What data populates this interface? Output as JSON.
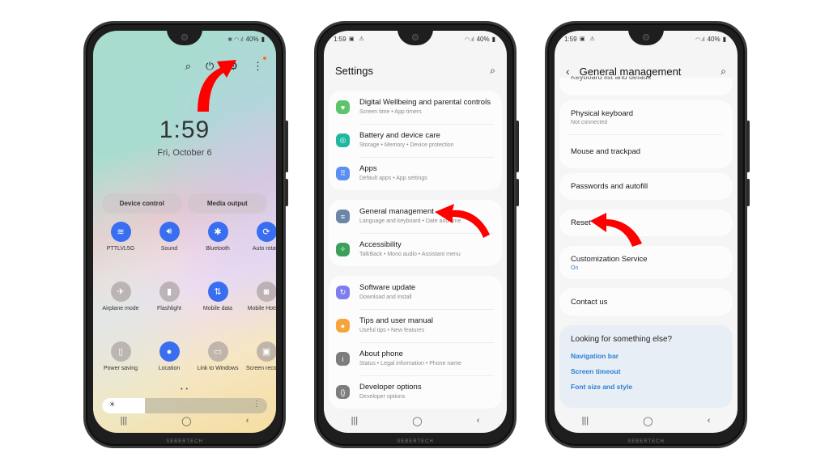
{
  "status_bar": {
    "time": "1:59",
    "battery": "40%",
    "notification_icons": "▣ ⚠",
    "signal_icons": "✱ ◠.ıl"
  },
  "phone1": {
    "top_icons": [
      "search-icon",
      "power-icon",
      "settings-gear-icon",
      "more-options-icon"
    ],
    "clock": "1:59",
    "date": "Fri, October 6",
    "pills": [
      "Device control",
      "Media output"
    ],
    "tiles": [
      {
        "label": "PTTLVL5G",
        "icon": "wifi-icon",
        "glyph": "≋",
        "on": true
      },
      {
        "label": "Sound",
        "icon": "sound-icon",
        "glyph": "🔊︎",
        "on": true
      },
      {
        "label": "Bluetooth",
        "icon": "bluetooth-icon",
        "glyph": "✱",
        "on": true
      },
      {
        "label": "Auto rotate",
        "icon": "auto-rotate-icon",
        "glyph": "⟳",
        "on": true
      },
      {
        "label": "Airplane mode",
        "icon": "airplane-icon",
        "glyph": "✈",
        "on": false
      },
      {
        "label": "Flashlight",
        "icon": "flashlight-icon",
        "glyph": "▮",
        "on": false
      },
      {
        "label": "Mobile data",
        "icon": "mobile-data-icon",
        "glyph": "⇅",
        "on": true
      },
      {
        "label": "Mobile Hotspot",
        "icon": "hotspot-icon",
        "glyph": "◙",
        "on": false
      },
      {
        "label": "Power saving",
        "icon": "power-saving-icon",
        "glyph": "▯",
        "on": false
      },
      {
        "label": "Location",
        "icon": "location-icon",
        "glyph": "●",
        "on": true
      },
      {
        "label": "Link to Windows",
        "icon": "link-to-windows-icon",
        "glyph": "▭",
        "on": false
      },
      {
        "label": "Screen recorder",
        "icon": "screen-recorder-icon",
        "glyph": "▣",
        "on": false
      }
    ],
    "page_dots": "• •",
    "brightness_level": 0.26
  },
  "phone2": {
    "title": "Settings",
    "groups": [
      [
        {
          "title": "Digital Wellbeing and parental controls",
          "subtitle": "Screen time  •  App timers",
          "icon": "digital-wellbeing-icon",
          "color": "#5cc56b",
          "glyph": "♥"
        },
        {
          "title": "Battery and device care",
          "subtitle": "Storage  •  Memory  •  Device protection",
          "icon": "battery-care-icon",
          "color": "#1fb7a0",
          "glyph": "◎"
        },
        {
          "title": "Apps",
          "subtitle": "Default apps  •  App settings",
          "icon": "apps-icon",
          "color": "#5b8ff2",
          "glyph": "⠿"
        }
      ],
      [
        {
          "title": "General management",
          "subtitle": "Language and keyboard  •  Date and time",
          "icon": "general-management-icon",
          "color": "#6b86a6",
          "glyph": "≡"
        },
        {
          "title": "Accessibility",
          "subtitle": "TalkBack  •  Mono audio  •  Assistant menu",
          "icon": "accessibility-icon",
          "color": "#3ca05a",
          "glyph": "✧"
        }
      ],
      [
        {
          "title": "Software update",
          "subtitle": "Download and install",
          "icon": "software-update-icon",
          "color": "#7d7df0",
          "glyph": "↻"
        },
        {
          "title": "Tips and user manual",
          "subtitle": "Useful tips  •  New features",
          "icon": "tips-icon",
          "color": "#f6a53a",
          "glyph": "●"
        },
        {
          "title": "About phone",
          "subtitle": "Status  •  Legal information  •  Phone name",
          "icon": "about-phone-icon",
          "color": "#7d7d7d",
          "glyph": "i"
        },
        {
          "title": "Developer options",
          "subtitle": "Developer options",
          "icon": "developer-options-icon",
          "color": "#7d7d7d",
          "glyph": "{}"
        }
      ]
    ]
  },
  "phone3": {
    "title": "General management",
    "cut_off_item": "Keyboard list and default",
    "items": [
      {
        "title": "Physical keyboard",
        "subtitle": "Not connected"
      },
      {
        "title": "Mouse and trackpad"
      },
      {
        "title": "Passwords and autofill"
      },
      {
        "title": "Reset"
      },
      {
        "title": "Customization Service",
        "subtitle": "On"
      },
      {
        "title": "Contact us"
      }
    ],
    "looking": {
      "heading": "Looking for something else?",
      "links": [
        "Navigation bar",
        "Screen timeout",
        "Font size and style"
      ]
    }
  },
  "nav": {
    "recents": "|||",
    "home": "◯",
    "back": "‹"
  },
  "watermark": "SEBERTECH",
  "colors": {
    "accent_blue": "#3a6ef0",
    "link_blue": "#2b7fd6",
    "arrow_red": "#ff0000"
  }
}
